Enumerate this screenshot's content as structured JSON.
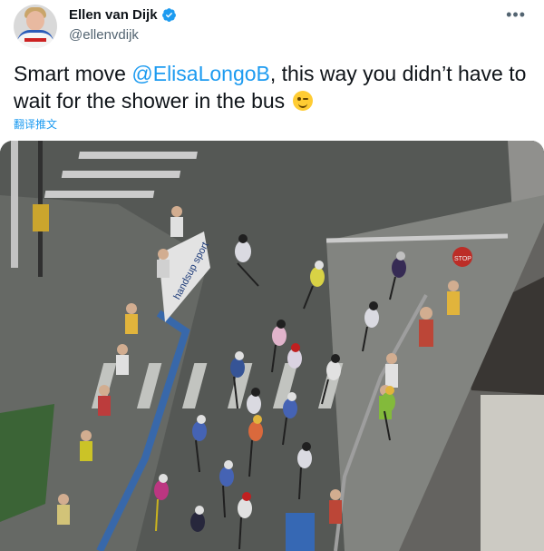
{
  "author": {
    "display_name": "Ellen van Dijk",
    "handle": "@ellenvdijk",
    "verified": true
  },
  "menu_icon": "more-horizontal-icon",
  "tweet": {
    "text_before": "Smart move ",
    "mention": "@ElisaLongoB",
    "text_after": ", this way you didn’t have to wait for the shower in the bus",
    "emoji": "winking-face"
  },
  "translate_label": "翻译推文",
  "media": {
    "banner_text": "handsup sport",
    "sign_text": "STOP",
    "colors": {
      "road": "#5b5e5b",
      "crossing": "#d8d8d8",
      "barrier": "#3c6fb5",
      "grass": "#3f6b3a"
    }
  }
}
